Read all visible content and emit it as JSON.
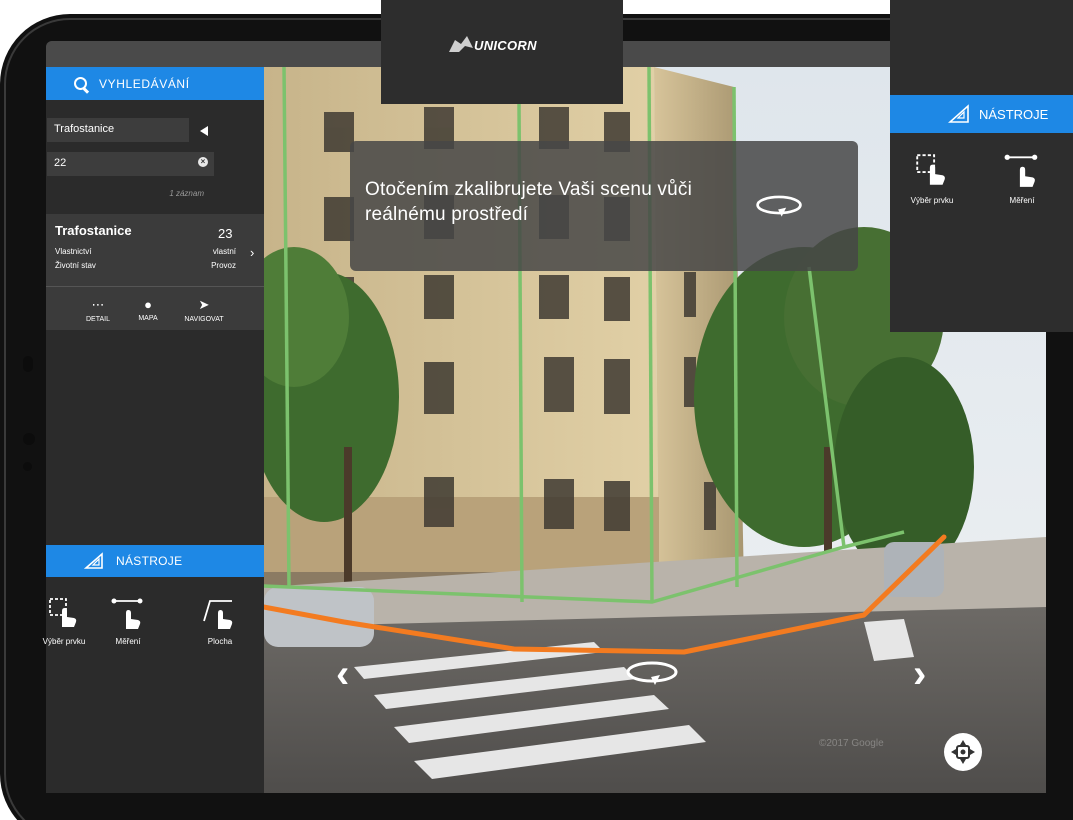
{
  "branding": {
    "logo_text": "UNICORN"
  },
  "search": {
    "header_label": "VYHLEDÁVÁNÍ",
    "layer_value": "Trafostanice",
    "query_value": "22",
    "result_count": "1 záznam"
  },
  "result": {
    "title": "Trafostanice",
    "number": "23",
    "attrs": [
      {
        "label": "Vlastnictví",
        "value": "vlastní"
      },
      {
        "label": "Životní stav",
        "value": "Provoz"
      }
    ],
    "actions": [
      {
        "label": "DETAIL",
        "icon": "more-dots-icon"
      },
      {
        "label": "MAPA",
        "icon": "map-pin-icon"
      },
      {
        "label": "NAVIGOVAT",
        "icon": "navigate-arrow-icon"
      }
    ]
  },
  "tools": {
    "header_label": "NÁSTROJE",
    "items": [
      {
        "label": "Výběr prvku",
        "icon": "select-feature-icon"
      },
      {
        "label": "Měření",
        "icon": "measure-icon"
      },
      {
        "label": "Plocha",
        "icon": "area-icon"
      }
    ]
  },
  "right_tools": {
    "header_label": "NÁSTROJE",
    "items": [
      {
        "label": "Výběr prvku",
        "icon": "select-feature-icon"
      },
      {
        "label": "Měření",
        "icon": "measure-icon"
      }
    ]
  },
  "tooltip": {
    "text": "Otočením zkalibrujete Vaši scenu vůči reálnému prostředí"
  },
  "scene": {
    "watermark": "©2017 Google"
  },
  "colors": {
    "accent": "#1e88e5",
    "overlay_line": "#7cc26d",
    "route_line": "#f37b20",
    "panel": "#2b2b2b"
  }
}
